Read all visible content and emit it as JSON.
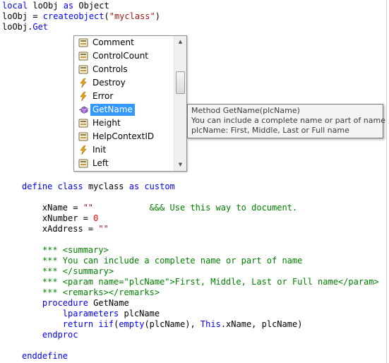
{
  "code": {
    "top": [
      {
        "parts": [
          [
            "local",
            "kw"
          ],
          [
            " loObj ",
            "bl"
          ],
          [
            "as",
            "kw"
          ],
          [
            " Object",
            "bl"
          ]
        ]
      },
      {
        "parts": [
          [
            "loObj = ",
            "bl"
          ],
          [
            "createobject",
            "kw"
          ],
          [
            "(",
            "bl"
          ],
          [
            "\"myclass\"",
            "str"
          ],
          [
            ")",
            "bl"
          ]
        ]
      },
      {
        "parts": [
          [
            "loObj.",
            "bl"
          ],
          [
            "Get",
            "kw"
          ]
        ]
      }
    ],
    "bottom": [
      {
        "parts": [
          [
            "define",
            "kw"
          ],
          [
            " ",
            "bl"
          ],
          [
            "class",
            "kw"
          ],
          [
            " myclass ",
            "bl"
          ],
          [
            "as",
            "kw"
          ],
          [
            " ",
            "bl"
          ],
          [
            "custom",
            "kw"
          ]
        ]
      },
      {
        "parts": []
      },
      {
        "parts": [
          [
            "    xName = ",
            "bl"
          ],
          [
            "\"\"",
            "str"
          ],
          [
            "           ",
            "bl"
          ],
          [
            "&&& Use this way to document.",
            "cmt"
          ]
        ]
      },
      {
        "parts": [
          [
            "    xNumber = ",
            "bl"
          ],
          [
            "0",
            "num"
          ]
        ]
      },
      {
        "parts": [
          [
            "    xAddress = ",
            "bl"
          ],
          [
            "\"\"",
            "str"
          ]
        ]
      },
      {
        "parts": []
      },
      {
        "parts": [
          [
            "    *** <summary>",
            "cmt"
          ]
        ]
      },
      {
        "parts": [
          [
            "    *** You can include a complete name or part of name",
            "cmt"
          ]
        ]
      },
      {
        "parts": [
          [
            "    *** </summary>",
            "cmt"
          ]
        ]
      },
      {
        "parts": [
          [
            "    *** <param name=\"plcName\">First, Middle, Last or Full name</param>",
            "cmt"
          ]
        ]
      },
      {
        "parts": [
          [
            "    *** <remarks></remarks>",
            "cmt"
          ]
        ]
      },
      {
        "parts": [
          [
            "    ",
            "bl"
          ],
          [
            "procedure",
            "kw"
          ],
          [
            " GetName",
            "bl"
          ]
        ]
      },
      {
        "parts": [
          [
            "        ",
            "bl"
          ],
          [
            "lparameters",
            "kw"
          ],
          [
            " plcName",
            "bl"
          ]
        ]
      },
      {
        "parts": [
          [
            "        ",
            "bl"
          ],
          [
            "return",
            "kw"
          ],
          [
            " ",
            "bl"
          ],
          [
            "iif",
            "kw"
          ],
          [
            "(",
            "bl"
          ],
          [
            "empty",
            "kw"
          ],
          [
            "(plcName), ",
            "bl"
          ],
          [
            "This",
            "kw"
          ],
          [
            ".xName, plcName)",
            "bl"
          ]
        ]
      },
      {
        "parts": [
          [
            "    ",
            "bl"
          ],
          [
            "endproc",
            "kw"
          ]
        ]
      },
      {
        "parts": []
      },
      {
        "parts": [
          [
            "enddefine",
            "kw"
          ]
        ]
      }
    ]
  },
  "intellisense": {
    "items": [
      {
        "label": "Comment",
        "icon": "property-icon"
      },
      {
        "label": "ControlCount",
        "icon": "property-icon"
      },
      {
        "label": "Controls",
        "icon": "property-icon"
      },
      {
        "label": "Destroy",
        "icon": "event-icon"
      },
      {
        "label": "Error",
        "icon": "event-icon"
      },
      {
        "label": "GetName",
        "icon": "method-icon",
        "selected": true
      },
      {
        "label": "Height",
        "icon": "property-icon"
      },
      {
        "label": "HelpContextID",
        "icon": "property-icon"
      },
      {
        "label": "Init",
        "icon": "event-icon"
      },
      {
        "label": "Left",
        "icon": "property-icon"
      }
    ],
    "scroll_up": "▲",
    "scroll_down": "▼"
  },
  "tooltip": {
    "line1": "Method GetName(plcName)",
    "line2": "You can include a complete name or part of name",
    "line3": "plcName: First, Middle, Last or Full name"
  },
  "colors": {
    "keyword": "#0000ff",
    "string": "#a31515",
    "comment": "#008000",
    "number": "#ff0000",
    "selection": "#3399ff"
  }
}
